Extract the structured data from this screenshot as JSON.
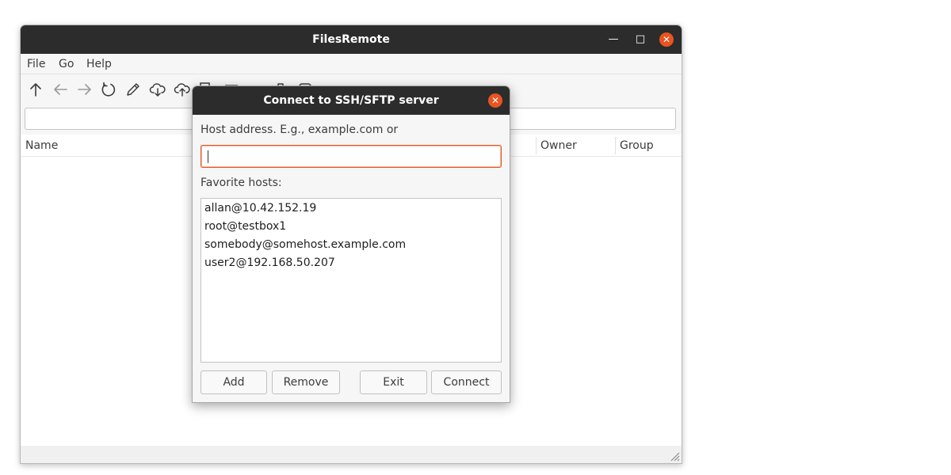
{
  "window": {
    "title": "FilesRemote",
    "minimize_glyph": "—",
    "maximize_glyph": "□",
    "close_glyph": "✕"
  },
  "menu": [
    "File",
    "Go",
    "Help"
  ],
  "toolbar": {
    "icons": [
      "up-arrow-icon",
      "back-arrow-icon",
      "forward-arrow-icon",
      "refresh-icon",
      "pencil-icon",
      "cloud-download-icon",
      "cloud-upload-icon",
      "copy-icon",
      "new-folder-icon",
      "download-icon",
      "trash-icon",
      "folder-icon"
    ]
  },
  "path": {
    "value": ""
  },
  "list": {
    "columns": [
      "Name",
      "Owner",
      "Group"
    ]
  },
  "dialog": {
    "title": "Connect to SSH/SFTP server",
    "close_glyph": "✕",
    "host_label": "Host address. E.g., example.com or",
    "host_value": "",
    "favorites_label": "Favorite hosts:",
    "favorites": [
      "allan@10.42.152.19",
      "root@testbox1",
      "somebody@somehost.example.com",
      "user2@192.168.50.207"
    ],
    "buttons": {
      "add": "Add",
      "remove": "Remove",
      "exit": "Exit",
      "connect": "Connect"
    }
  },
  "colors": {
    "titlebar": "#2c2c2c",
    "accent": "#e95420",
    "toolbar_icon": "#3c3c3c",
    "toolbar_icon_disabled": "#9a9a9a"
  }
}
